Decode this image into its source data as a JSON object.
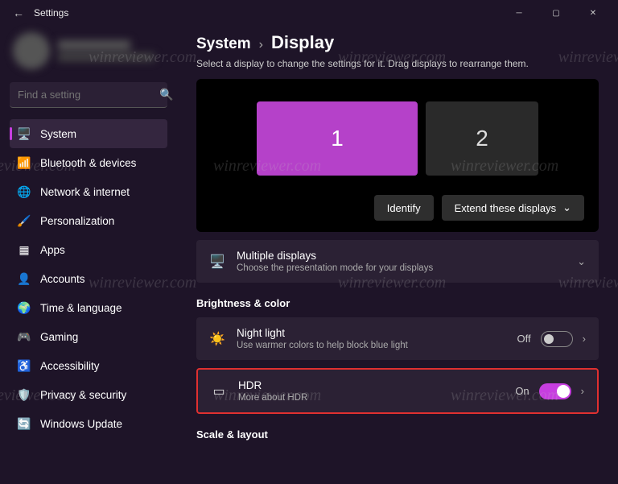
{
  "titlebar": {
    "title": "Settings"
  },
  "search": {
    "placeholder": "Find a setting"
  },
  "nav": {
    "items": [
      {
        "label": "System"
      },
      {
        "label": "Bluetooth & devices"
      },
      {
        "label": "Network & internet"
      },
      {
        "label": "Personalization"
      },
      {
        "label": "Apps"
      },
      {
        "label": "Accounts"
      },
      {
        "label": "Time & language"
      },
      {
        "label": "Gaming"
      },
      {
        "label": "Accessibility"
      },
      {
        "label": "Privacy & security"
      },
      {
        "label": "Windows Update"
      }
    ]
  },
  "breadcrumb": {
    "parent": "System",
    "current": "Display"
  },
  "subhead": "Select a display to change the settings for it. Drag displays to rearrange them.",
  "monitors": {
    "one": "1",
    "two": "2"
  },
  "buttons": {
    "identify": "Identify",
    "extend": "Extend these displays"
  },
  "cards": {
    "multi": {
      "title": "Multiple displays",
      "sub": "Choose the presentation mode for your displays"
    },
    "night": {
      "title": "Night light",
      "sub": "Use warmer colors to help block blue light",
      "state": "Off"
    },
    "hdr": {
      "title": "HDR",
      "sub": "More about HDR",
      "state": "On"
    }
  },
  "sections": {
    "brightness": "Brightness & color",
    "scale": "Scale & layout"
  },
  "watermark": "winreviewer.com"
}
